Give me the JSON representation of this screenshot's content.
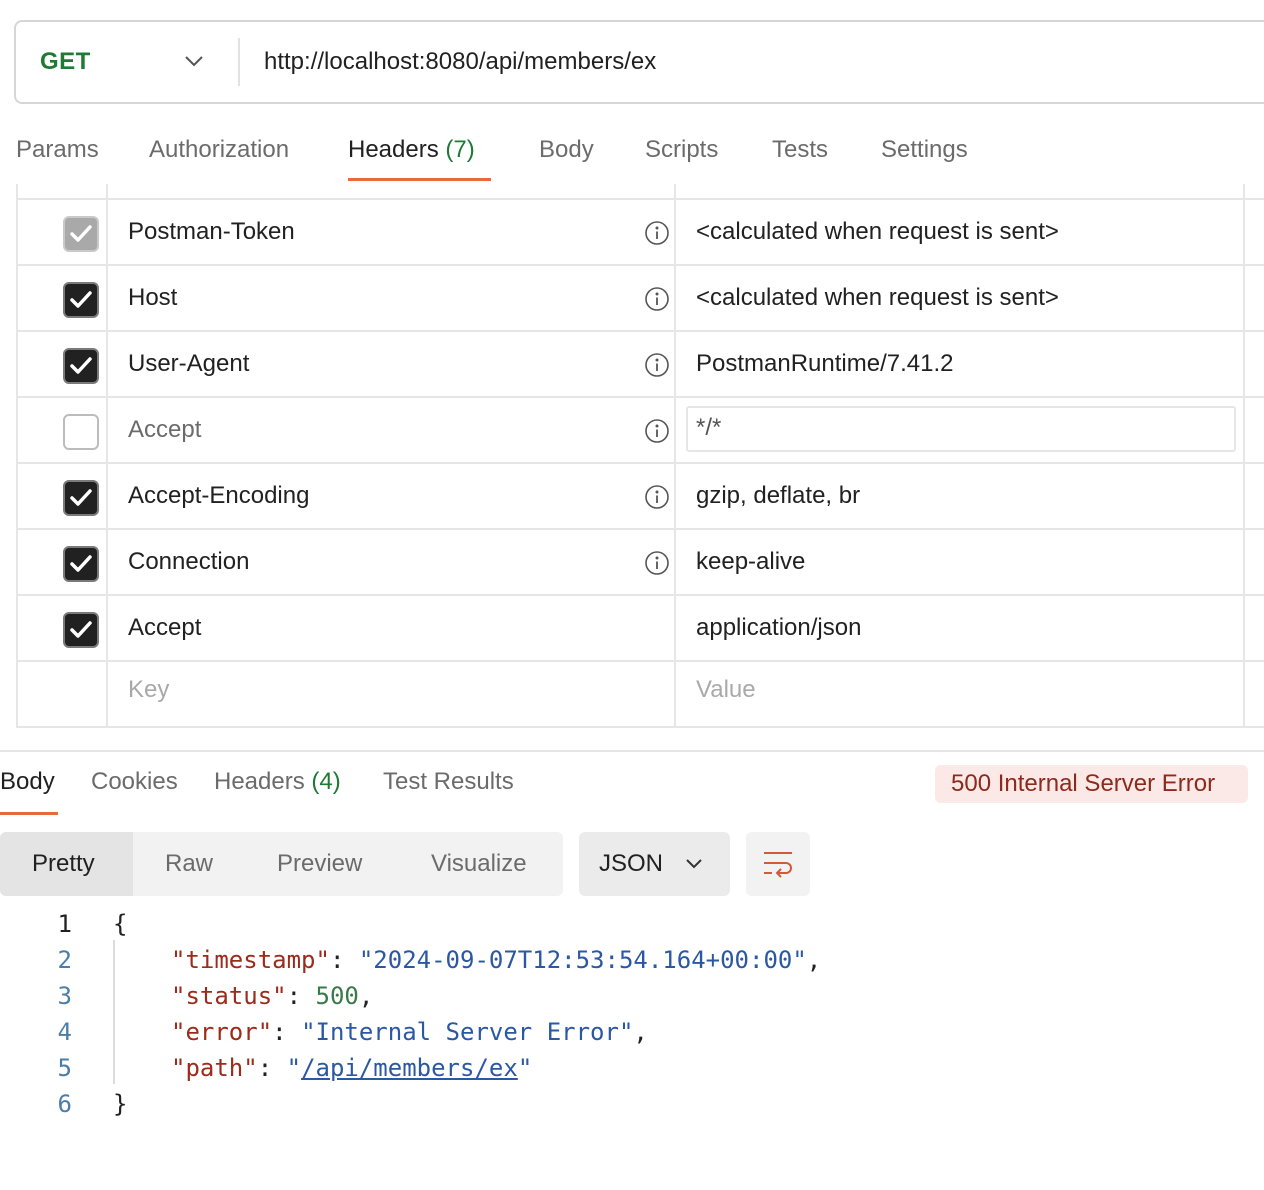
{
  "request": {
    "method": "GET",
    "url": "http://localhost:8080/api/members/ex"
  },
  "request_tabs": [
    {
      "label": "Params"
    },
    {
      "label": "Authorization"
    },
    {
      "label": "Headers",
      "count": "(7)"
    },
    {
      "label": "Body"
    },
    {
      "label": "Scripts"
    },
    {
      "label": "Tests"
    },
    {
      "label": "Settings"
    }
  ],
  "headers": [
    {
      "key": "Postman-Token",
      "value": "<calculated when request is sent>",
      "state": "disabled-checked",
      "info": true
    },
    {
      "key": "Host",
      "value": "<calculated when request is sent>",
      "state": "checked",
      "info": true
    },
    {
      "key": "User-Agent",
      "value": "PostmanRuntime/7.41.2",
      "state": "checked",
      "info": true
    },
    {
      "key": "Accept",
      "value": "*/*",
      "state": "unchecked",
      "info": true
    },
    {
      "key": "Accept-Encoding",
      "value": "gzip, deflate, br",
      "state": "checked",
      "info": true
    },
    {
      "key": "Connection",
      "value": "keep-alive",
      "state": "checked",
      "info": true
    },
    {
      "key": "Accept",
      "value": "application/json",
      "state": "checked",
      "info": false
    }
  ],
  "header_placeholders": {
    "key": "Key",
    "value": "Value"
  },
  "response_tabs": [
    {
      "label": "Body"
    },
    {
      "label": "Cookies"
    },
    {
      "label": "Headers",
      "count": "(4)"
    },
    {
      "label": "Test Results"
    }
  ],
  "status": "500 Internal Server Error",
  "view_modes": [
    "Pretty",
    "Raw",
    "Preview",
    "Visualize"
  ],
  "format": "JSON",
  "code": {
    "line_numbers": [
      "1",
      "2",
      "3",
      "4",
      "5",
      "6"
    ],
    "open_brace": "{",
    "close_brace": "}",
    "timestamp_key": "\"timestamp\"",
    "timestamp_val": "\"2024-09-07T12:53:54.164+00:00\"",
    "status_key": "\"status\"",
    "status_val": "500",
    "error_key": "\"error\"",
    "error_val": "\"Internal Server Error\"",
    "path_key": "\"path\"",
    "path_quote": "\"",
    "path_val": "/api/members/ex",
    "colon": ": ",
    "comma": ","
  },
  "colors": {
    "method": "#1f7a35",
    "accent": "#e76a3c",
    "error_badge_bg": "#fbe9e7",
    "error_badge_text": "#8c2a1c"
  },
  "icons": {
    "method_dropdown": "chevron-down-icon",
    "info": "info-icon",
    "checkbox": "check-icon",
    "format_dropdown": "chevron-down-icon",
    "wrap": "wrap-lines-icon"
  }
}
